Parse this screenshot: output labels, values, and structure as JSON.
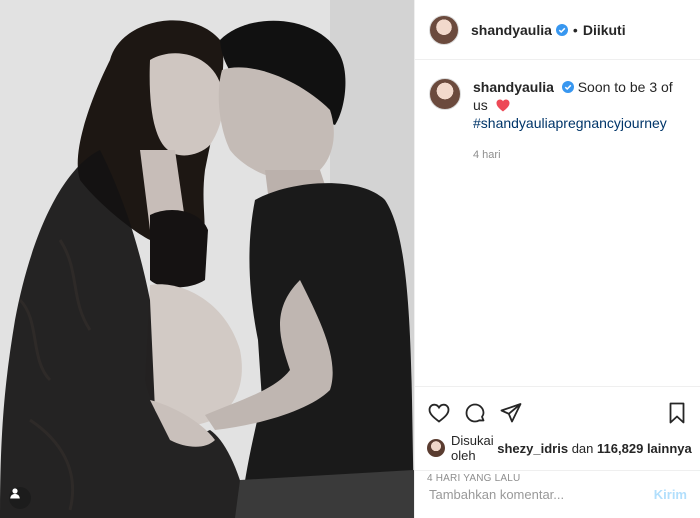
{
  "header": {
    "username": "shandyaulia",
    "separator": "•",
    "follow_status": "Diikuti"
  },
  "caption": {
    "username": "shandyaulia",
    "text": "Soon to be 3 of us",
    "hashtag": "#shandyauliapregnancyjourney",
    "time_ago": "4 hari"
  },
  "actions": {
    "icons": [
      "heart-icon",
      "comment-icon",
      "share-icon",
      "bookmark-icon"
    ]
  },
  "likes": {
    "prefix": "Disukai oleh",
    "user": "shezy_idris",
    "middle": "dan",
    "count": "116,829",
    "suffix": "lainnya"
  },
  "date": "4 HARI YANG LALU",
  "comment_box": {
    "placeholder": "Tambahkan komentar...",
    "post_label": "Kirim"
  },
  "colors": {
    "verified": "#3897f0",
    "heart": "#ed4956",
    "hashtag": "#003569",
    "post_disabled": "#b2dffc"
  }
}
